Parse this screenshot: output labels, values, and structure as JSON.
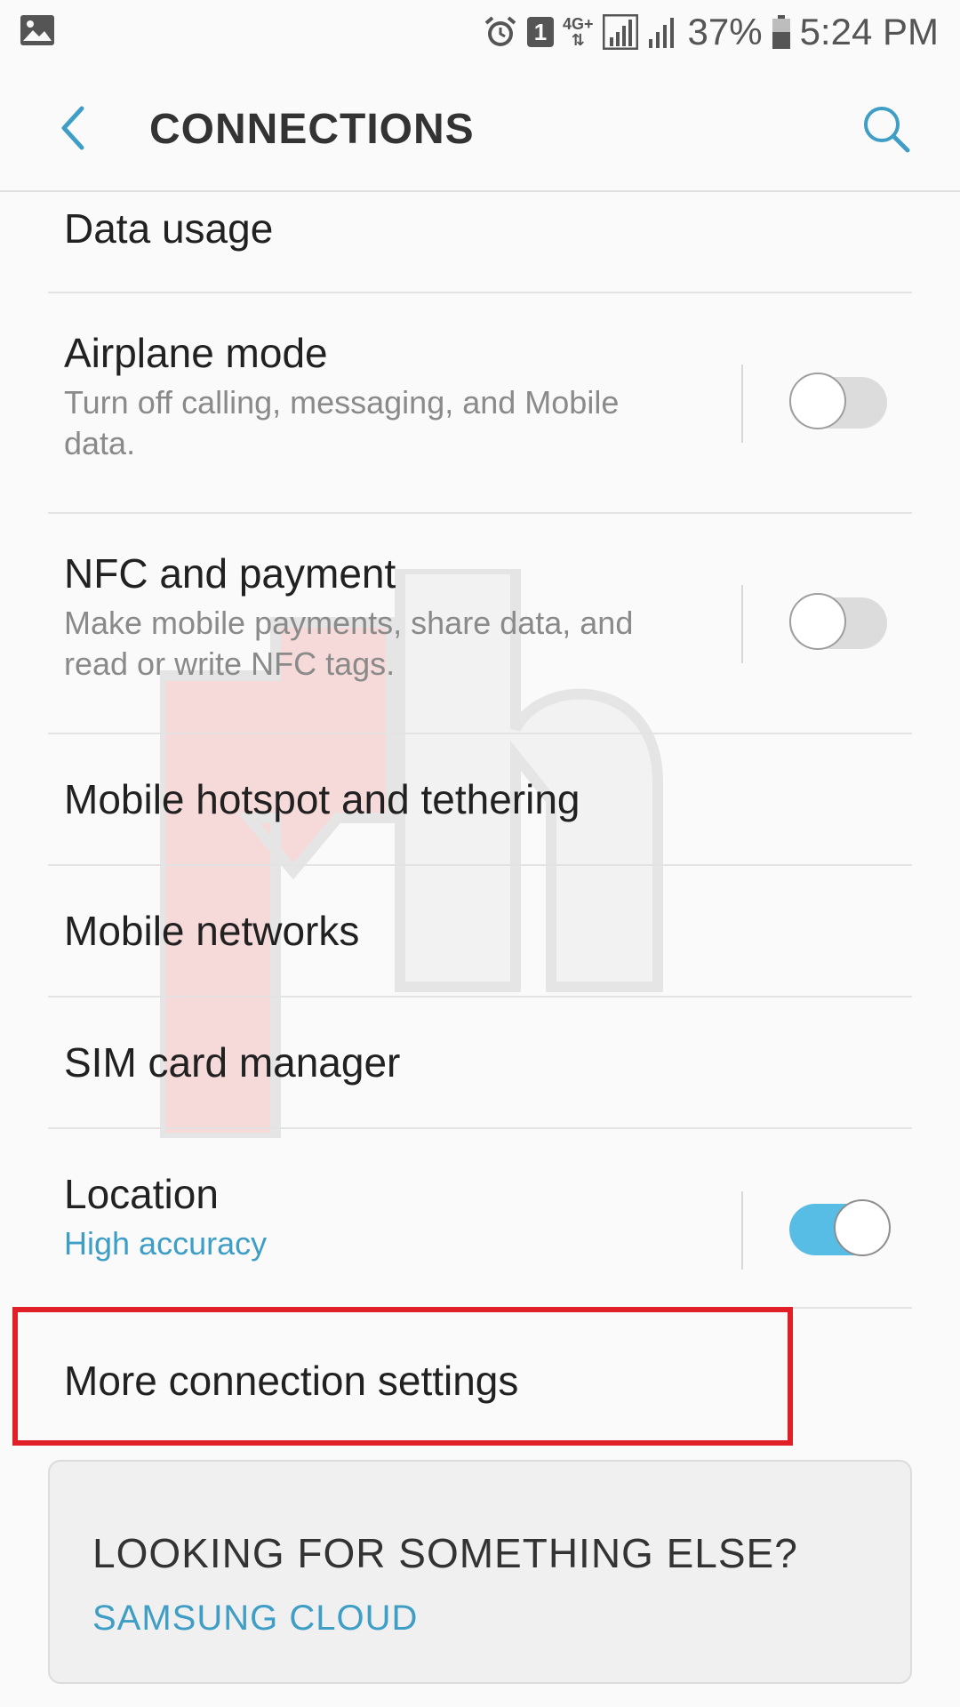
{
  "status_bar": {
    "battery": "37%",
    "time": "5:24 PM",
    "sim_slot": "1",
    "network_type": "4G+",
    "icons": [
      "gallery-icon",
      "alarm-icon",
      "sim-icon",
      "data-arrows-icon",
      "signal-icon",
      "signal-icon-2",
      "battery-icon"
    ]
  },
  "app_bar": {
    "title": "CONNECTIONS",
    "icons": [
      "back-arrow-icon",
      "search-icon"
    ]
  },
  "settings": {
    "data_usage": {
      "title": "Data usage"
    },
    "airplane_mode": {
      "title": "Airplane mode",
      "subtitle": "Turn off calling, messaging, and Mobile data.",
      "enabled": false
    },
    "nfc": {
      "title": "NFC and payment",
      "subtitle": "Make mobile payments, share data, and read or write NFC tags.",
      "enabled": false
    },
    "hotspot": {
      "title": "Mobile hotspot and tethering"
    },
    "mobile_networks": {
      "title": "Mobile networks"
    },
    "sim_manager": {
      "title": "SIM card manager"
    },
    "location": {
      "title": "Location",
      "subtitle": "High accuracy",
      "enabled": true
    },
    "more": {
      "title": "More connection settings"
    }
  },
  "suggestion_card": {
    "heading": "LOOKING FOR SOMETHING ELSE?",
    "link": "SAMSUNG CLOUD"
  },
  "colors": {
    "accent": "#3e9ec6",
    "switch_on": "#58bde4",
    "highlight": "#e01f26"
  }
}
